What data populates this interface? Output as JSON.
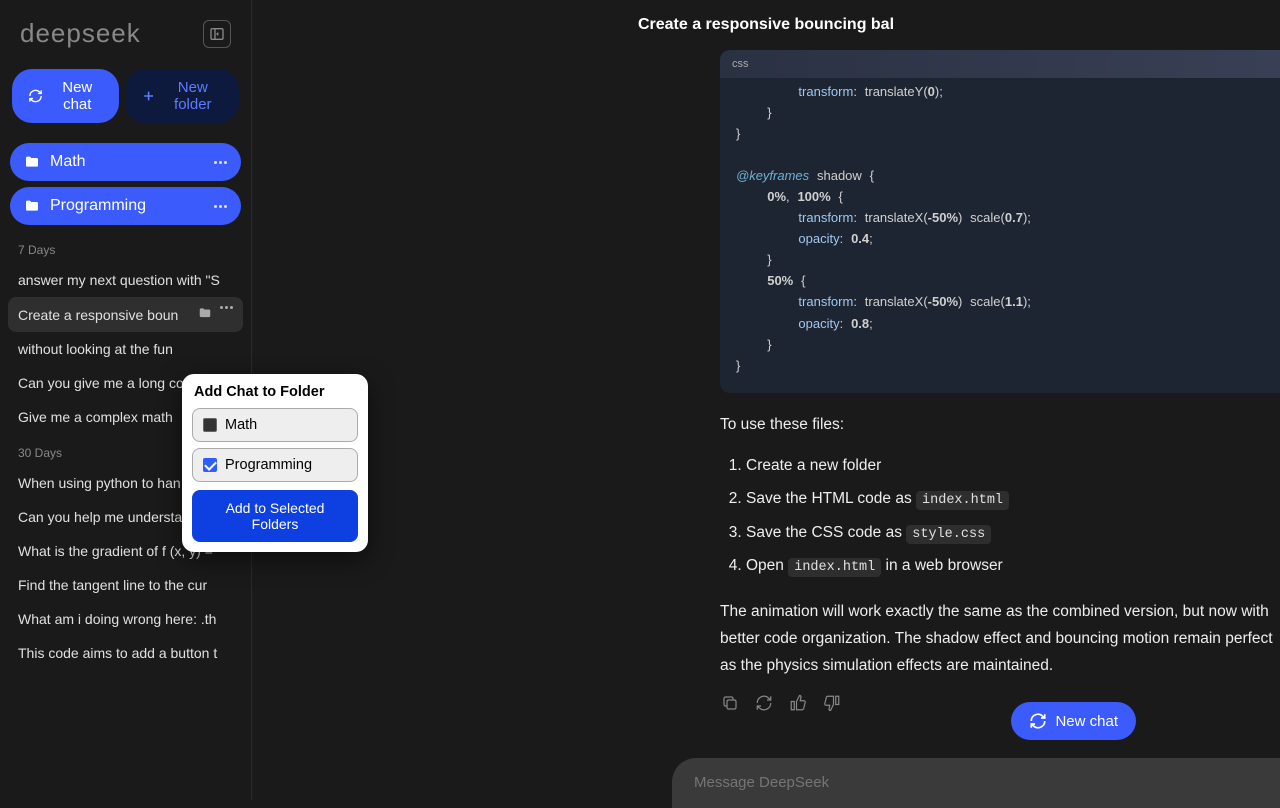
{
  "brand": "deepseek",
  "sidebar": {
    "new_chat": "New chat",
    "new_folder": "New folder",
    "folders": [
      "Math",
      "Programming"
    ],
    "section_7": "7 Days",
    "section_30": "30 Days",
    "chats_7": [
      "answer my next question with \"S",
      "Create a responsive boun",
      "without looking at the fun",
      "Can you give me a long co",
      "Give me a complex math"
    ],
    "chats_30": [
      "When using python to han",
      "Can you help me understand thi",
      "What is the gradient of f (x, y) =",
      "Find the tangent line to the cur",
      "What am i doing wrong here: .th",
      "This code aims to add a button t"
    ]
  },
  "header": {
    "title": "Create a responsive bouncing bal"
  },
  "code": {
    "lang": "css"
  },
  "response": {
    "intro": "To use these files:",
    "steps": {
      "s1": "Create a new folder",
      "s2a": "Save the HTML code as ",
      "s2b": "index.html",
      "s3a": "Save the CSS code as ",
      "s3b": "style.css",
      "s4a": "Open ",
      "s4b": "index.html",
      "s4c": " in a web browser"
    },
    "para": "The animation will work exactly the same as the combined version, but now with better code organization. The shadow effect and bouncing motion remain perfect as the physics simulation effects are maintained."
  },
  "buttons": {
    "new_chat_pill": "New chat"
  },
  "composer": {
    "placeholder": "Message DeepSeek"
  },
  "popup": {
    "title": "Add Chat to Folder",
    "opt1": "Math",
    "opt2": "Programming",
    "submit": "Add to Selected Folders"
  }
}
